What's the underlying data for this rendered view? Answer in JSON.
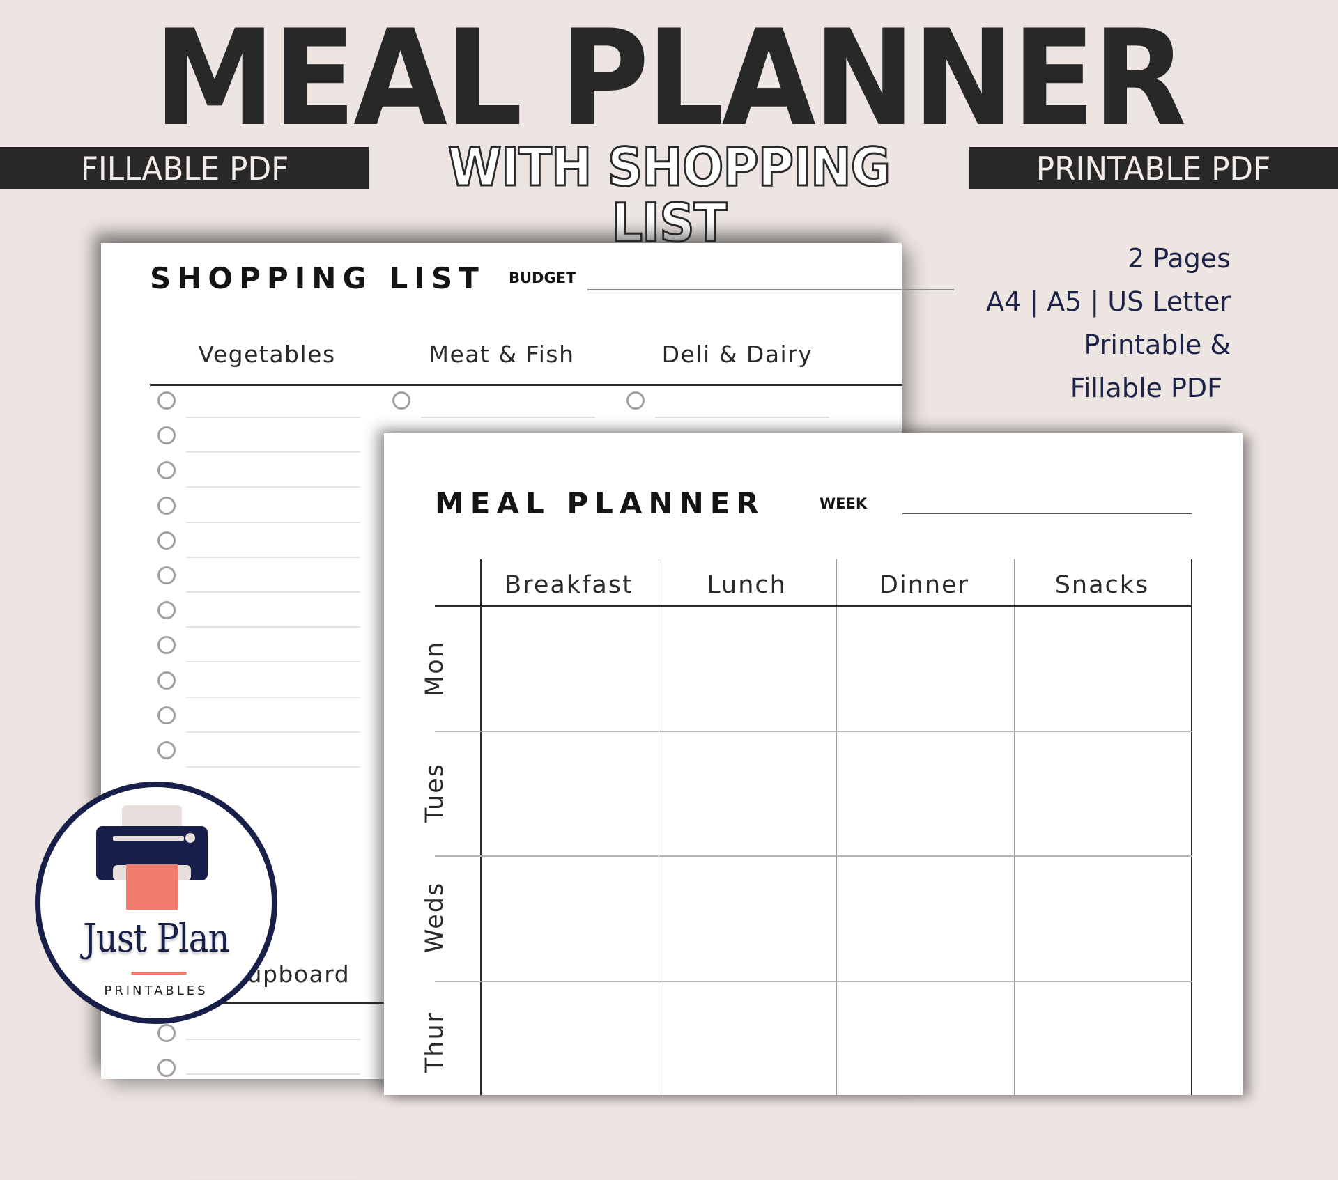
{
  "banner": {
    "title": "MEAL PLANNER",
    "subtitle": "WITH SHOPPING LIST",
    "left_tag": "FILLABLE PDF",
    "right_tag": "PRINTABLE PDF"
  },
  "info": {
    "lines": [
      "2 Pages",
      "A4 | A5 | US Letter",
      "Printable &",
      "Fillable PDF"
    ]
  },
  "shopping_list": {
    "title": "SHOPPING LIST",
    "budget_label": "BUDGET",
    "columns": [
      "Vegetables",
      "Meat & Fish",
      "Deli & Dairy"
    ],
    "section_two": "Cupboard",
    "checkbox_rows_visible": 11
  },
  "meal_planner": {
    "title": "MEAL PLANNER",
    "week_label": "WEEK",
    "meals": [
      "Breakfast",
      "Lunch",
      "Dinner",
      "Snacks"
    ],
    "days": [
      "Mon",
      "Tues",
      "Weds",
      "Thur"
    ]
  },
  "logo": {
    "brand": "Just Plan",
    "sub": "PRINTABLES",
    "colors": {
      "navy": "#18204a",
      "coral": "#f07c6c"
    }
  },
  "colors": {
    "background": "#ede5e1",
    "dark": "#282828",
    "info_text": "#1e2448"
  }
}
